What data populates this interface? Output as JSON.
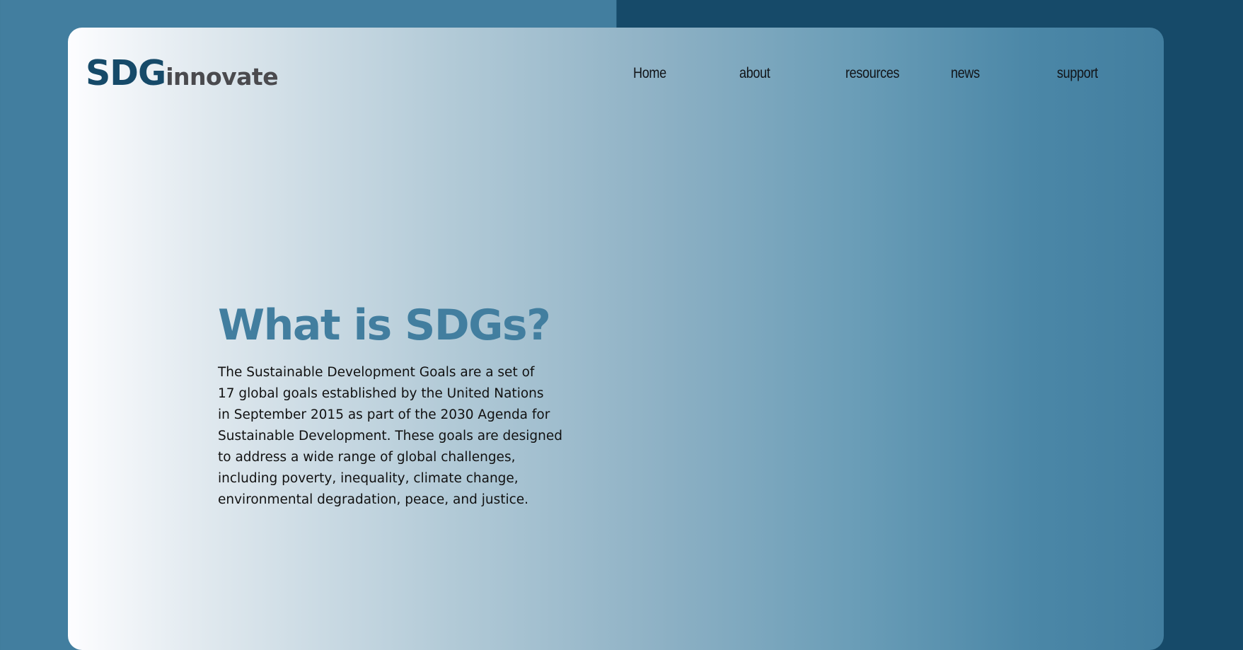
{
  "brand": {
    "primary": "SDG",
    "secondary": "innovate",
    "primary_color": "#164a69",
    "secondary_color": "#4a4a4e"
  },
  "nav": {
    "items": [
      {
        "label": "Home"
      },
      {
        "label": "about"
      },
      {
        "label": "resources"
      },
      {
        "label": "news"
      },
      {
        "label": "support"
      }
    ]
  },
  "hero": {
    "title": "What is SDGs?",
    "lines": [
      "The Sustainable Development Goals are a set of",
      "17 global goals established by the United Nations",
      "in September 2015 as part of the 2030 Agenda for",
      "Sustainable Development. These goals are designed",
      "to address a wide range of global challenges,",
      "including poverty, inequality, climate change,",
      "environmental degradation, peace, and justice."
    ],
    "title_color": "#427e9f"
  },
  "colors": {
    "page_left": "#427e9f",
    "page_right": "#164a69",
    "card_start": "#fdfdff",
    "card_end": "#427e9f"
  }
}
